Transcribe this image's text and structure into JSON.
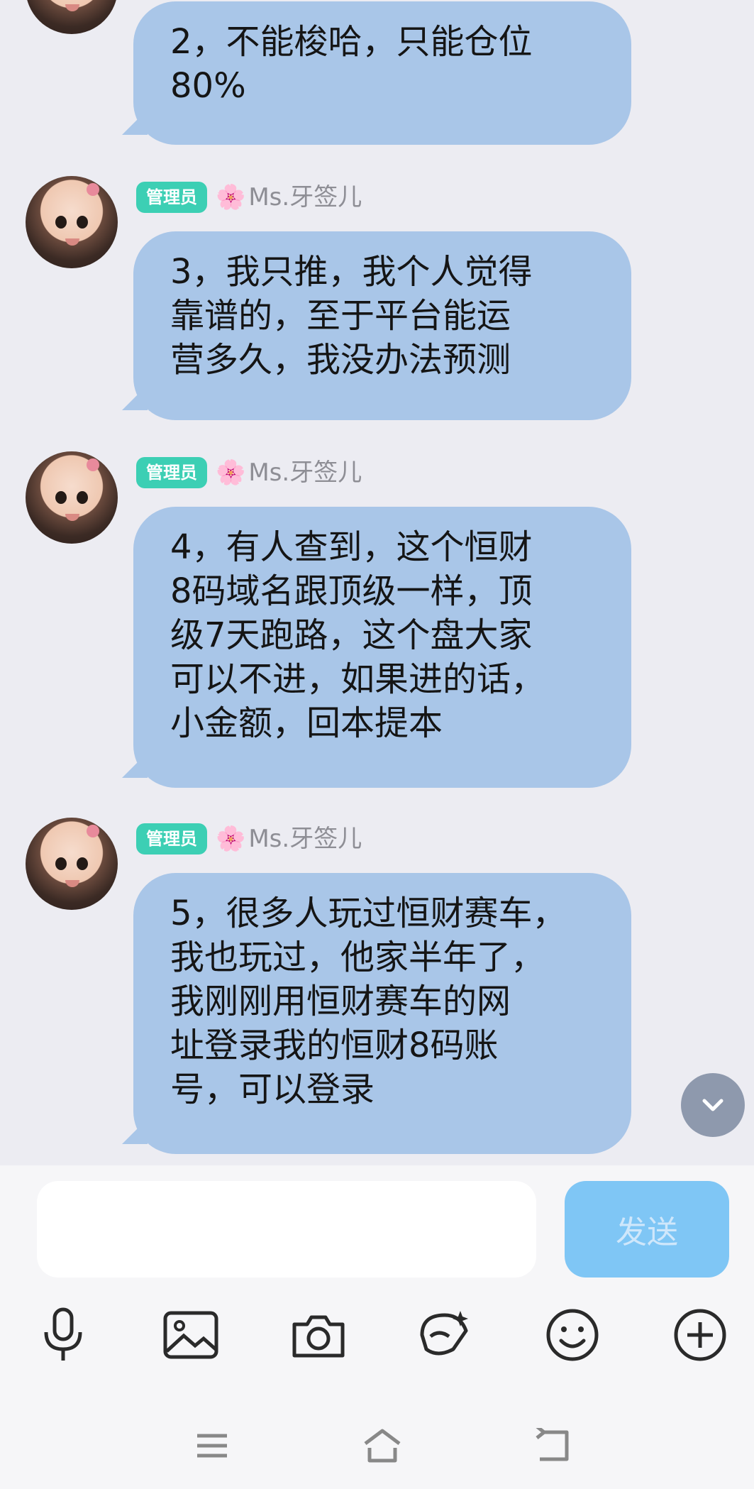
{
  "messages": [
    {
      "role_badge": "",
      "flower": "",
      "nickname": "",
      "text": "2，不能梭哈，只能仓位\n80%"
    },
    {
      "role_badge": "管理员",
      "flower": "🌸",
      "nickname": "Ms.牙签儿",
      "text": "3，我只推，我个人觉得\n靠谱的，至于平台能运\n营多久，我没办法预测"
    },
    {
      "role_badge": "管理员",
      "flower": "🌸",
      "nickname": "Ms.牙签儿",
      "text": "4，有人查到，这个恒财\n8码域名跟顶级一样，顶\n级7天跑路，这个盘大家\n可以不进，如果进的话，\n小金额，回本提本"
    },
    {
      "role_badge": "管理员",
      "flower": "🌸",
      "nickname": "Ms.牙签儿",
      "text": "5，很多人玩过恒财赛车，\n我也玩过，他家半年了，\n我刚刚用恒财赛车的网\n址登录我的恒财8码账\n号，可以登录"
    }
  ],
  "composer": {
    "input_value": "",
    "input_placeholder": "",
    "send_label": "发送"
  },
  "toolbar": [
    "microphone-icon",
    "image-icon",
    "camera-icon",
    "ai-sticker-icon",
    "emoji-icon",
    "plus-icon"
  ],
  "navbar": [
    "menu-icon",
    "home-icon",
    "back-icon"
  ],
  "colors": {
    "background": "#ececf2",
    "bubble": "#a9c6e8",
    "admin_badge": "#3ccfb4",
    "send_button": "#7fc6f5"
  }
}
